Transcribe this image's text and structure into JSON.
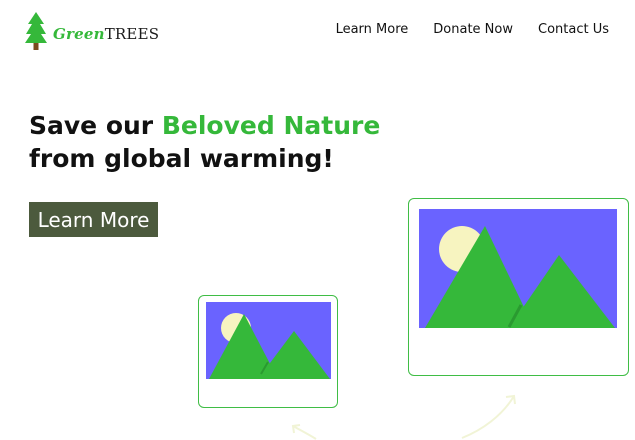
{
  "brand": {
    "name_part1": "Green",
    "name_part2": "TREES",
    "logo_icon": "pine-tree-icon",
    "accent_color": "#35b83a"
  },
  "nav": {
    "items": [
      {
        "label": "Learn More"
      },
      {
        "label": "Donate Now"
      },
      {
        "label": "Contact Us"
      }
    ]
  },
  "hero": {
    "title_part1": "Save our ",
    "title_accent": "Beloved Nature",
    "title_part2": "from global warming!",
    "cta_label": "Learn More",
    "cta_color": "#4c5a3d"
  },
  "gallery": {
    "images": [
      {
        "icon": "image-placeholder-icon",
        "sky_color": "#6a63ff",
        "mountain_color": "#35b83a",
        "sun_color": "#f7f4c0"
      },
      {
        "icon": "image-placeholder-icon",
        "sky_color": "#6a63ff",
        "mountain_color": "#35b83a",
        "sun_color": "#f7f4c0"
      }
    ]
  }
}
